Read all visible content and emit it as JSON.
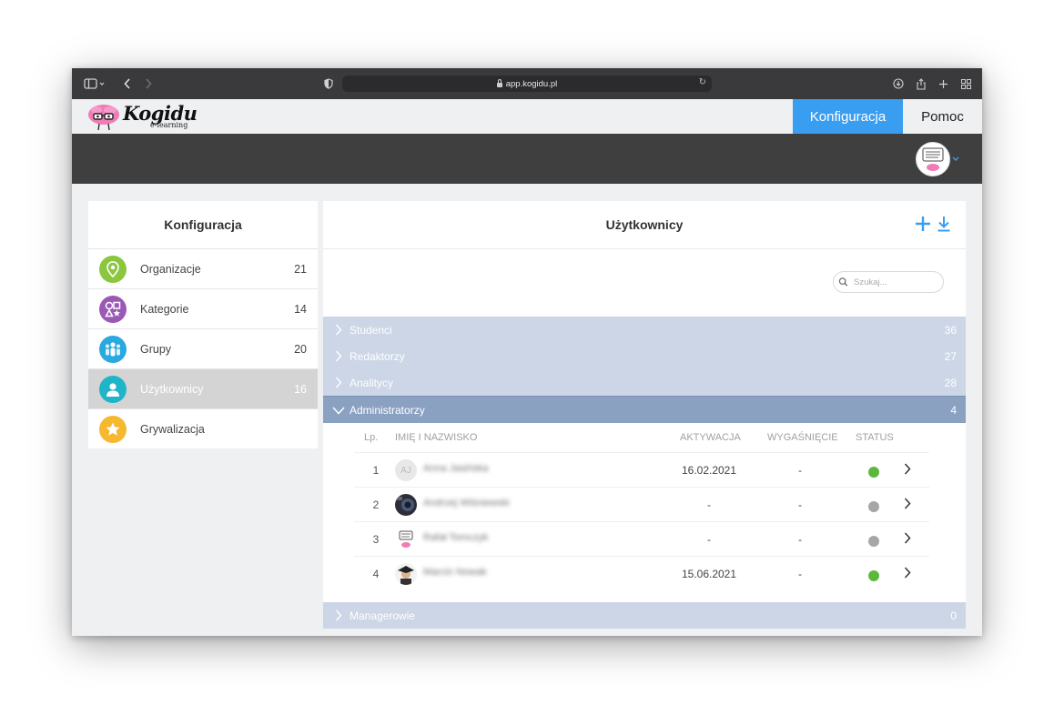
{
  "browser": {
    "url": "app.kogidu.pl"
  },
  "app": {
    "logo_name": "Kogidu",
    "logo_sub": "e-learning",
    "nav": {
      "konfiguracja": "Konfiguracja",
      "pomoc": "Pomoc"
    }
  },
  "sidebar": {
    "title": "Konfiguracja",
    "items": [
      {
        "label": "Organizacje",
        "count": "21",
        "icon": "location-pin-icon",
        "color": "#8cc63f"
      },
      {
        "label": "Kategorie",
        "count": "14",
        "icon": "shapes-icon",
        "color": "#9b59b6"
      },
      {
        "label": "Grupy",
        "count": "20",
        "icon": "group-icon",
        "color": "#29a9e0"
      },
      {
        "label": "Użytkownicy",
        "count": "16",
        "icon": "user-icon",
        "color": "#1fb5c9",
        "active": true
      },
      {
        "label": "Grywalizacja",
        "count": "",
        "icon": "star-icon",
        "color": "#f5b82e"
      }
    ]
  },
  "main": {
    "title": "Użytkownicy",
    "search_placeholder": "Szukaj...",
    "groups_before": [
      {
        "label": "Studenci",
        "count": "36"
      },
      {
        "label": "Redaktorzy",
        "count": "27"
      },
      {
        "label": "Analitycy",
        "count": "28"
      }
    ],
    "open_group": {
      "label": "Administratorzy",
      "count": "4"
    },
    "group_after": {
      "label": "Managerowie",
      "count": "0"
    },
    "table": {
      "headers": {
        "lp": "Lp.",
        "name": "IMIĘ I NAZWISKO",
        "activation": "AKTYWACJA",
        "expiry": "WYGAŚNIĘCIE",
        "status": "STATUS"
      },
      "rows": [
        {
          "num": "1",
          "avatar_text": "AJ",
          "name": "Anna Jasińska",
          "activation": "16.02.2021",
          "expiry": "-",
          "status": "active"
        },
        {
          "num": "2",
          "avatar_text": "",
          "name": "Andrzej Wiśniewski",
          "activation": "-",
          "expiry": "-",
          "status": "inactive"
        },
        {
          "num": "3",
          "avatar_text": "",
          "name": "Rafał Tomczyk",
          "activation": "-",
          "expiry": "-",
          "status": "inactive"
        },
        {
          "num": "4",
          "avatar_text": "",
          "name": "Marcin Nowak",
          "activation": "15.06.2021",
          "expiry": "-",
          "status": "active"
        }
      ]
    }
  },
  "colors": {
    "accent": "#3a9ef0",
    "status_active": "#5cb83a",
    "status_inactive": "#a6a6a6",
    "group_collapsed": "#ccd6e6",
    "group_open": "#8aa1c2"
  }
}
